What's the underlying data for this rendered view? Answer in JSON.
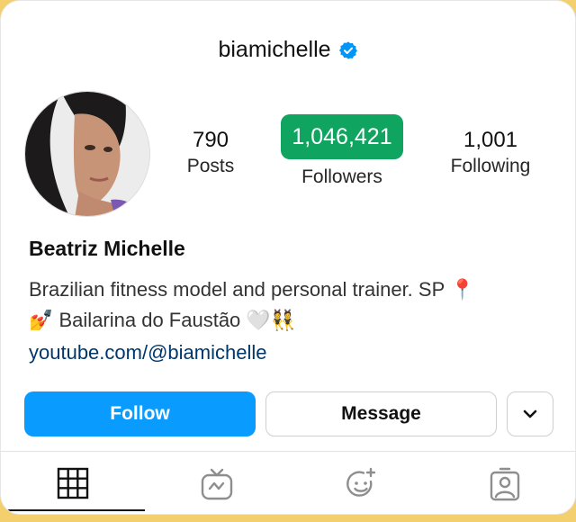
{
  "profile": {
    "username": "biamichelle",
    "full_name": "Beatriz Michelle",
    "bio_line1": "Brazilian fitness model and personal trainer. SP 📍",
    "bio_line2": "💅 Bailarina do Faustão 🤍👯",
    "link": "youtube.com/@biamichelle"
  },
  "stats": {
    "posts": {
      "value": "790",
      "label": "Posts"
    },
    "followers": {
      "value": "1,046,421",
      "label": "Followers"
    },
    "following": {
      "value": "1,001",
      "label": "Following"
    }
  },
  "actions": {
    "follow_label": "Follow",
    "message_label": "Message"
  },
  "tabs": [
    {
      "icon": "grid-icon",
      "active": true
    },
    {
      "icon": "igtv-icon",
      "active": false
    },
    {
      "icon": "effects-icon",
      "active": false
    },
    {
      "icon": "tagged-icon",
      "active": false
    }
  ],
  "colors": {
    "follow_button": "#0a9bff",
    "followers_badge": "#0fa561",
    "verified_badge": "#0095f6",
    "link": "#00376b",
    "page_background": "#f3cf6e"
  }
}
